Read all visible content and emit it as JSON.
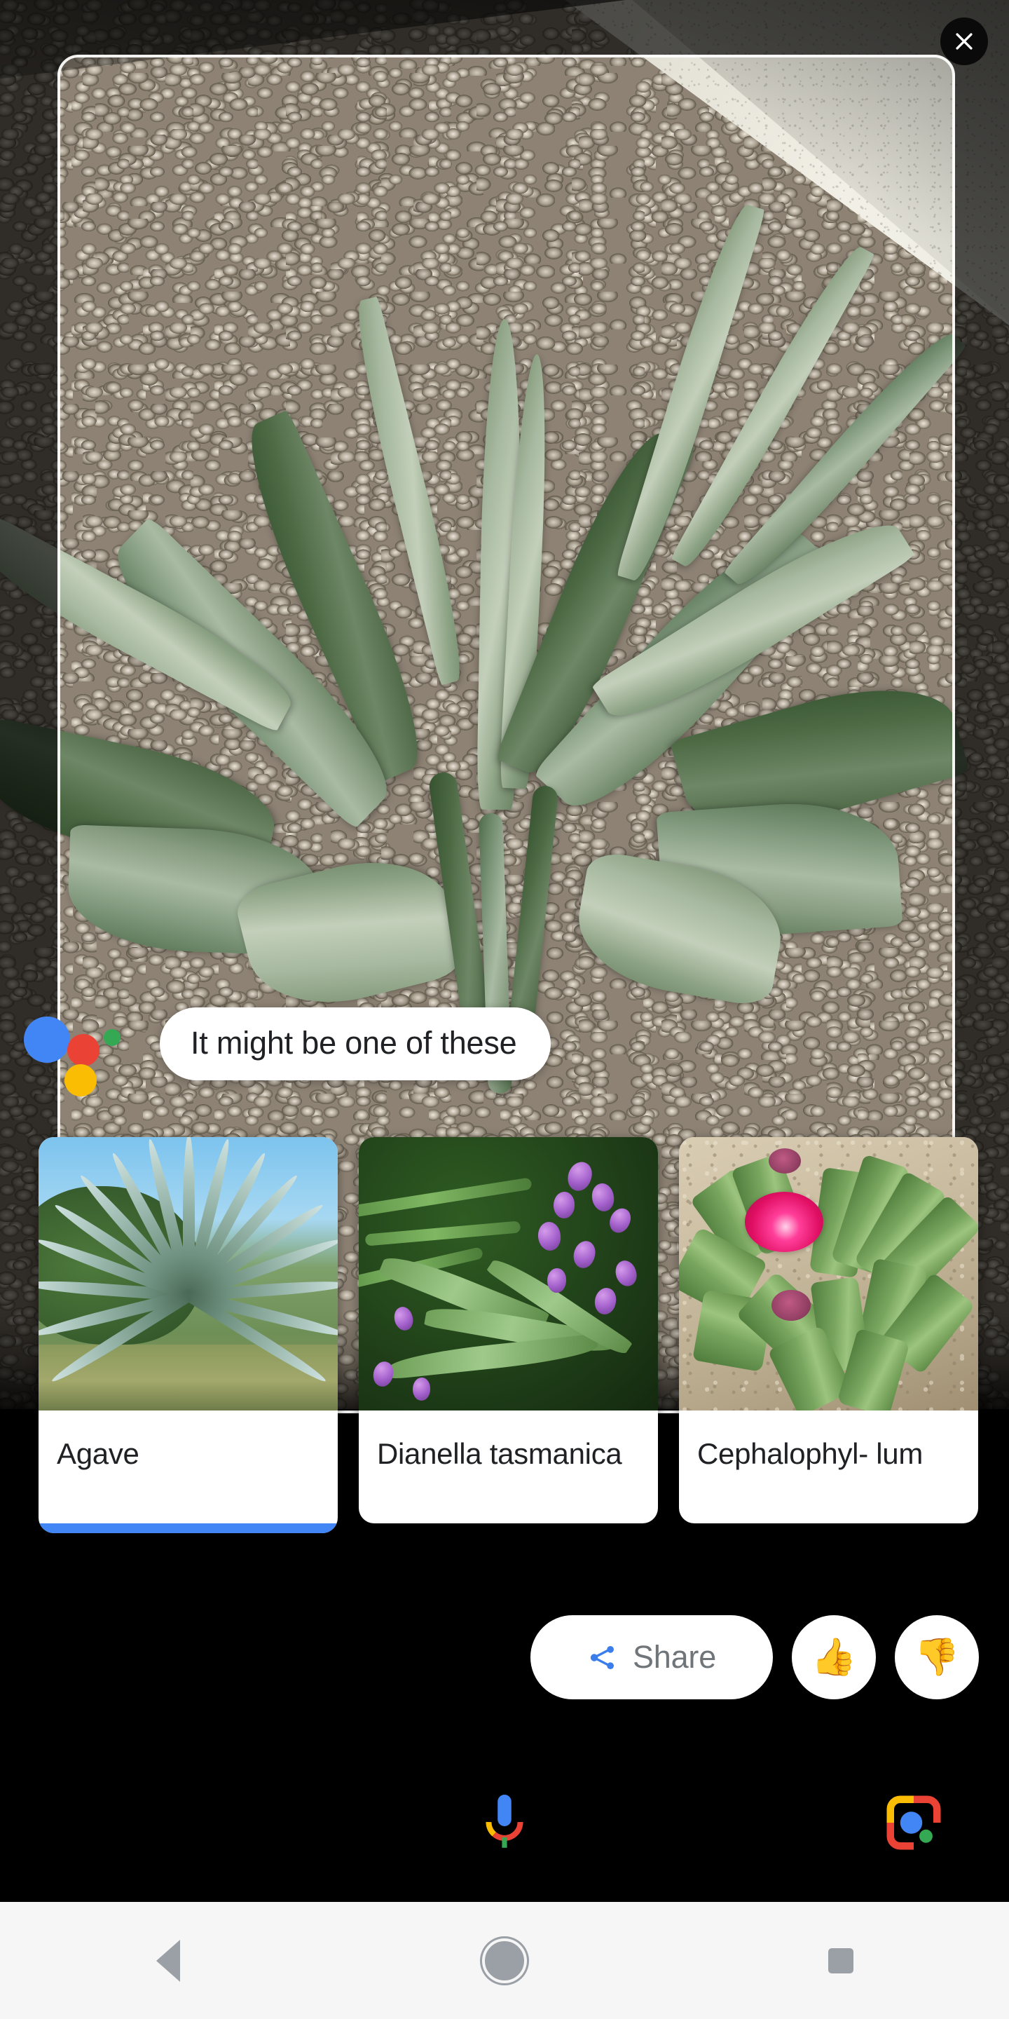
{
  "app": {
    "name": "Google Lens",
    "screen_background": "#000000"
  },
  "colors": {
    "google_blue": "#4285F4",
    "google_red": "#EA4335",
    "google_yellow": "#FBBC04",
    "google_green": "#34A853",
    "selected_card_bar": "#4286F5",
    "card_background": "#FFFFFF",
    "card_text": "#202124",
    "share_label": "#70757A",
    "navbar_background": "#F6F6F6",
    "navbar_icon": "#9AA0A6"
  },
  "viewfinder": {
    "close_label": "Close",
    "close_icon": "close-icon",
    "frame_label": "Lens capture frame"
  },
  "assistant": {
    "dots_icon": "google-assistant-dots-icon",
    "dot_colors": [
      "#4285F4",
      "#EA4335",
      "#FBBC04",
      "#34A853"
    ],
    "message": "It might be one of these"
  },
  "results": {
    "cards": [
      {
        "label": "Agave",
        "thumb_icon": "agave-plant-thumbnail",
        "selected": true
      },
      {
        "label": "Dianella tasmanica",
        "thumb_icon": "dianella-plant-thumbnail",
        "selected": false
      },
      {
        "label": "Cephalophyl-\nlum",
        "thumb_icon": "cephalophyllum-plant-thumbnail",
        "selected": false
      }
    ]
  },
  "actions": {
    "share": {
      "label": "Share",
      "icon": "share-icon"
    },
    "thumbs_up": {
      "label": "👍",
      "icon": "thumbs-up-icon"
    },
    "thumbs_down": {
      "label": "👎",
      "icon": "thumbs-down-icon"
    }
  },
  "bottom_bar": {
    "mic": {
      "icon": "google-mic-icon",
      "label": "Voice search"
    },
    "lens": {
      "icon": "google-lens-icon",
      "label": "Lens"
    }
  },
  "navbar": {
    "back": {
      "icon": "nav-back-icon",
      "label": "Back"
    },
    "home": {
      "icon": "nav-home-icon",
      "label": "Home"
    },
    "recents": {
      "icon": "nav-recents-icon",
      "label": "Recents"
    }
  }
}
